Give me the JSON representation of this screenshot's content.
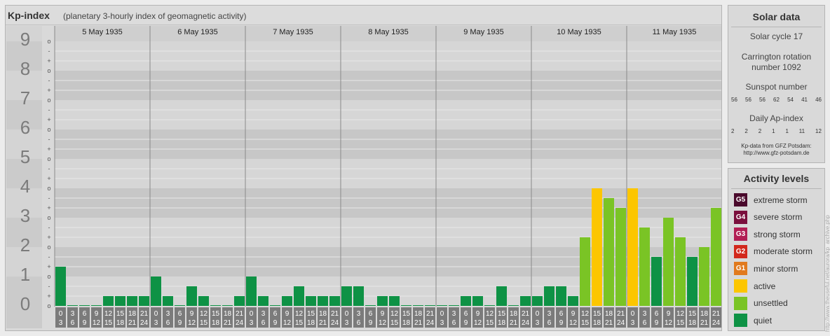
{
  "kp_panel": {
    "title": "Kp-index",
    "subtitle": "(planetary 3-hourly index of geomagnetic activity)"
  },
  "chart_data": {
    "type": "bar",
    "title": "Kp-index",
    "subtitle": "(planetary 3-hourly index of geomagnetic activity)",
    "ylim": [
      0,
      9
    ],
    "y_ticks": [
      "0",
      "1",
      "2",
      "3",
      "4",
      "5",
      "6",
      "7",
      "8",
      "9"
    ],
    "y_minor_labels": [
      "o",
      "+",
      "-"
    ],
    "days": [
      "5 May 1935",
      "6 May 1935",
      "7 May 1935",
      "8 May 1935",
      "9 May 1935",
      "10 May 1935",
      "11 May 1935"
    ],
    "interval_starts": [
      "0",
      "3",
      "6",
      "9",
      "12",
      "15",
      "18",
      "21"
    ],
    "interval_ends": [
      "3",
      "6",
      "9",
      "12",
      "15",
      "18",
      "21",
      "24"
    ],
    "values": [
      [
        1.333,
        0.0,
        0.0,
        0.0,
        0.333,
        0.333,
        0.333,
        0.333
      ],
      [
        1.0,
        0.333,
        0.0,
        0.667,
        0.333,
        0.0,
        0.0,
        0.333
      ],
      [
        1.0,
        0.333,
        0.0,
        0.333,
        0.667,
        0.333,
        0.333,
        0.333
      ],
      [
        0.667,
        0.667,
        0.0,
        0.333,
        0.333,
        0.0,
        0.0,
        0.0
      ],
      [
        0.0,
        0.0,
        0.333,
        0.333,
        0.0,
        0.667,
        0.0,
        0.333
      ],
      [
        0.333,
        0.667,
        0.667,
        0.333,
        2.333,
        4.0,
        3.667,
        3.333
      ],
      [
        4.0,
        2.667,
        1.667,
        3.0,
        2.333,
        1.667,
        2.0,
        3.333
      ]
    ],
    "levels": [
      {
        "name": "quiet",
        "color": "#0e9245",
        "min": 0,
        "max": 2
      },
      {
        "name": "unsettled",
        "color": "#7ac425",
        "min": 2,
        "max": 4
      },
      {
        "name": "active",
        "color": "#fcc600",
        "min": 4,
        "max": 5
      },
      {
        "name": "minor storm",
        "color": "#e17a1e",
        "min": 5,
        "max": 6
      },
      {
        "name": "moderate storm",
        "color": "#d2281c",
        "min": 6,
        "max": 7
      },
      {
        "name": "strong storm",
        "color": "#b21e54",
        "min": 7,
        "max": 8
      },
      {
        "name": "severe storm",
        "color": "#7a0f3d",
        "min": 8,
        "max": 9
      },
      {
        "name": "extreme storm",
        "color": "#4a0a2c",
        "min": 9,
        "max": 10
      }
    ]
  },
  "solar_data": {
    "heading": "Solar data",
    "solar_cycle": "Solar cycle 17",
    "carrington_line1": "Carrington rotation",
    "carrington_line2": "number 1092",
    "sunspot_heading": "Sunspot number",
    "sunspot_values": [
      "56",
      "56",
      "56",
      "62",
      "54",
      "41",
      "46"
    ],
    "ap_heading": "Daily Ap-index",
    "ap_values": [
      "2",
      "2",
      "2",
      "1",
      "1",
      "11",
      "12"
    ],
    "credit_line1": "Kp-data from GFZ Potsdam:",
    "credit_line2": "http://www.gfz-potsdam.de"
  },
  "activity_levels": {
    "heading": "Activity levels",
    "items": [
      {
        "badge": "G5",
        "label": "extreme storm",
        "color": "#4a0a2c"
      },
      {
        "badge": "G4",
        "label": "severe storm",
        "color": "#7a0f3d"
      },
      {
        "badge": "G3",
        "label": "strong storm",
        "color": "#b21e54"
      },
      {
        "badge": "G2",
        "label": "moderate storm",
        "color": "#d2281c"
      },
      {
        "badge": "G1",
        "label": "minor storm",
        "color": "#e17a1e"
      },
      {
        "badge": "",
        "label": "active",
        "color": "#fcc600"
      },
      {
        "badge": "",
        "label": "unsettled",
        "color": "#7ac425"
      },
      {
        "badge": "",
        "label": "quiet",
        "color": "#0e9245"
      }
    ]
  },
  "watermark": "http://www.theuseful.net/aurora/kp_archive.php"
}
